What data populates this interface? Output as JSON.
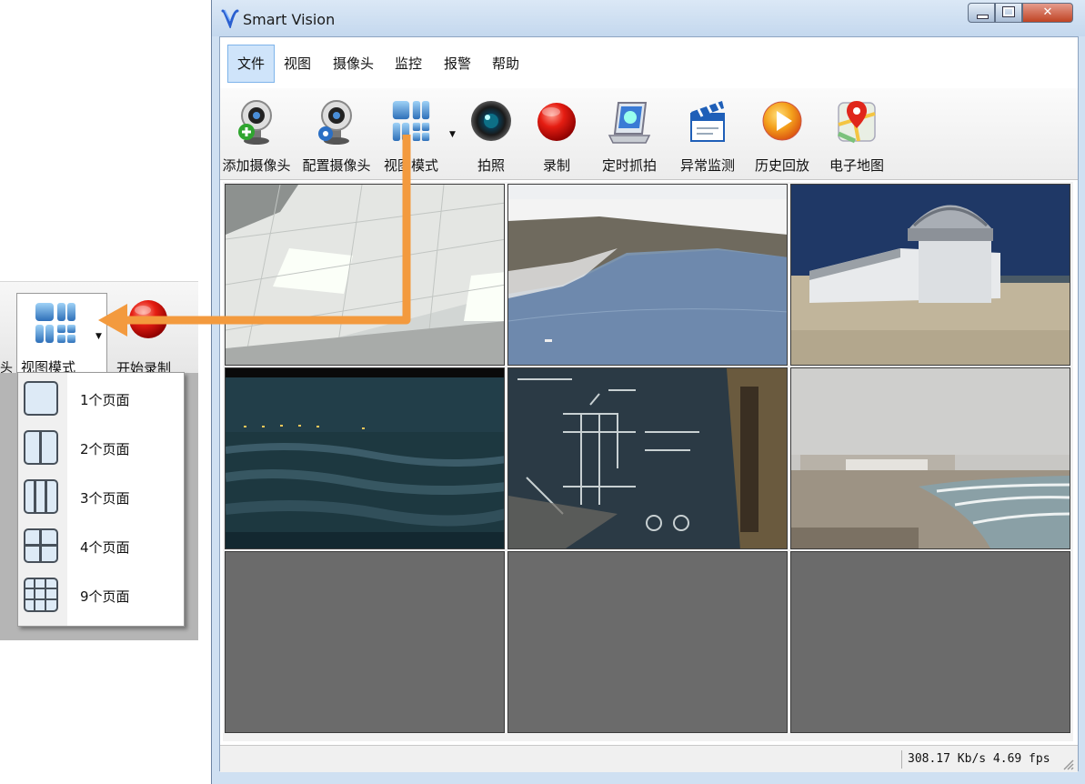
{
  "window": {
    "title": "Smart Vision",
    "close_glyph": "✕"
  },
  "menubar": {
    "items": [
      {
        "label": "文件",
        "active": true
      },
      {
        "label": "视图"
      },
      {
        "label": "摄像头"
      },
      {
        "label": "监控"
      },
      {
        "label": "报警"
      },
      {
        "label": "帮助"
      }
    ]
  },
  "toolbar": {
    "buttons": [
      {
        "label": "添加摄像头",
        "icon": "add-camera-icon"
      },
      {
        "label": "配置摄像头",
        "icon": "configure-camera-icon"
      },
      {
        "label": "视图模式",
        "icon": "view-mode-icon"
      },
      {
        "label": "拍照",
        "icon": "camera-lens-icon"
      },
      {
        "label": "录制",
        "icon": "record-icon"
      },
      {
        "label": "定时抓拍",
        "icon": "scheduled-capture-icon"
      },
      {
        "label": "异常监测",
        "icon": "clapperboard-icon"
      },
      {
        "label": "历史回放",
        "icon": "play-icon"
      },
      {
        "label": "电子地图",
        "icon": "map-pin-icon"
      }
    ]
  },
  "grid": {
    "cells": [
      {
        "scene": "office-ceiling-lights"
      },
      {
        "scene": "snowy-village-lake"
      },
      {
        "scene": "observatory-dome"
      },
      {
        "scene": "night-coastline"
      },
      {
        "scene": "chalkboard"
      },
      {
        "scene": "beach-surf"
      },
      {
        "scene": "empty"
      },
      {
        "scene": "empty"
      },
      {
        "scene": "empty"
      }
    ]
  },
  "status": {
    "text": "308.17 Kb/s 4.69 fps"
  },
  "inset": {
    "cut_label": "头",
    "view_mode_label": "视图模式",
    "record_label": "开始录制",
    "dropdown": [
      {
        "label": "1个页面",
        "icon": "layout-1-icon"
      },
      {
        "label": "2个页面",
        "icon": "layout-2-icon"
      },
      {
        "label": "3个页面",
        "icon": "layout-3-icon"
      },
      {
        "label": "4个页面",
        "icon": "layout-4-icon"
      },
      {
        "label": "9个页面",
        "icon": "layout-9-icon"
      }
    ]
  },
  "colors": {
    "arrow": "#f39a3e",
    "empty_cell": "#6b6b6b",
    "menu_active_bg": "#cfe4fa"
  }
}
